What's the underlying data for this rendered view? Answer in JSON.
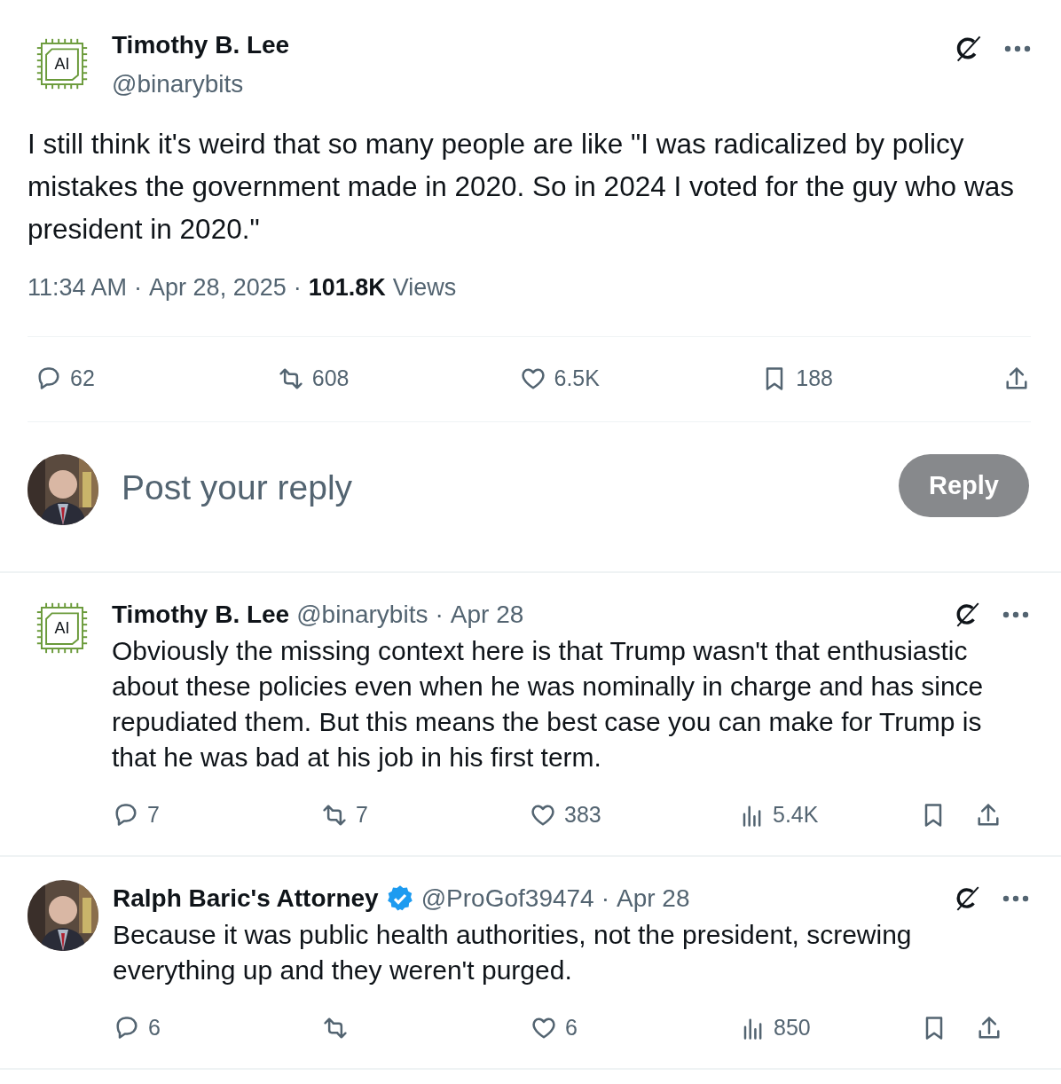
{
  "tweet": {
    "author": {
      "name": "Timothy B. Lee",
      "handle": "@binarybits",
      "avatar": {
        "kind": "logo",
        "text": "AI"
      }
    },
    "text": "I still think it's weird that so many people are like \"I was  radicalized by policy mistakes the government made in 2020. So in 2024 I voted for the guy who was president in 2020.\"",
    "time": "11:34 AM",
    "separator": "·",
    "date": "Apr 28, 2025",
    "views_count": "101.8K",
    "views_label": "Views",
    "actions": [
      {
        "kind": "reply",
        "count": "62"
      },
      {
        "kind": "repost",
        "count": "608"
      },
      {
        "kind": "like",
        "count": "6.5K"
      },
      {
        "kind": "bookmark",
        "count": "188"
      },
      {
        "kind": "share"
      }
    ]
  },
  "reply_box": {
    "placeholder": "Post your reply",
    "button": "Reply",
    "disabled": true
  },
  "replies": [
    {
      "name": "Timothy B. Lee",
      "verified": false,
      "handle": "@binarybits",
      "separator": "·",
      "date": "Apr 28",
      "avatar": {
        "kind": "logo",
        "text": "AI"
      },
      "text": "Obviously the missing context here is that Trump wasn't that enthusiastic about these policies even when he was nominally in charge and has since repudiated them. But this means the best case you can make for Trump is that he was bad at his job in his first term.",
      "actions": [
        {
          "kind": "reply",
          "count": "7"
        },
        {
          "kind": "repost",
          "count": "7"
        },
        {
          "kind": "like",
          "count": "383"
        },
        {
          "kind": "views",
          "count": "5.4K"
        },
        {
          "kind": "bookmark"
        },
        {
          "kind": "share"
        }
      ]
    },
    {
      "name": "Ralph Baric's Attorney",
      "verified": true,
      "handle": "@ProGof39474",
      "separator": "·",
      "date": "Apr 28",
      "text": "Because it was public health authorities, not the president, screwing everything up and they weren't purged.",
      "actions": [
        {
          "kind": "reply",
          "count": "6"
        },
        {
          "kind": "repost"
        },
        {
          "kind": "like",
          "count": "6"
        },
        {
          "kind": "views",
          "count": "850"
        },
        {
          "kind": "bookmark"
        },
        {
          "kind": "share"
        }
      ]
    }
  ]
}
